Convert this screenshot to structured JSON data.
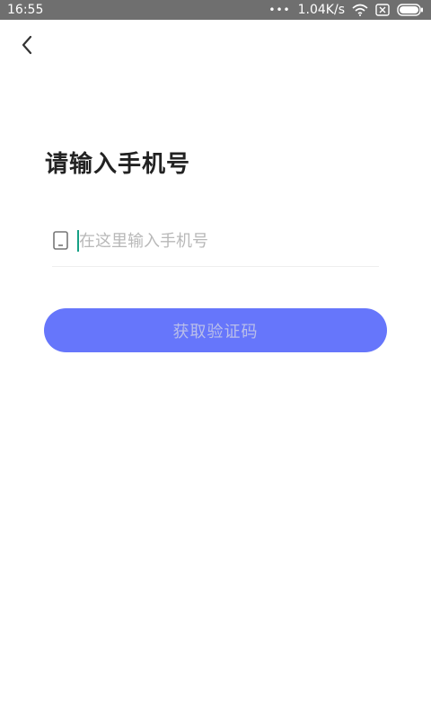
{
  "status_bar": {
    "time": "16:55",
    "dots": "•••",
    "network_speed": "1.04K/s",
    "icons": [
      "wifi-icon",
      "sim-icon",
      "battery-icon"
    ]
  },
  "header": {
    "back_icon": "chevron-left-icon"
  },
  "page": {
    "title": "请输入手机号"
  },
  "phone_field": {
    "icon": "phone-icon",
    "value": "",
    "placeholder": "在这里输入手机号"
  },
  "actions": {
    "get_code_label": "获取验证码"
  },
  "colors": {
    "accent": "#6676fb",
    "button_text_disabled": "#b9beea",
    "cursor": "#16a085",
    "status_bar_bg": "#6f6f6f"
  }
}
